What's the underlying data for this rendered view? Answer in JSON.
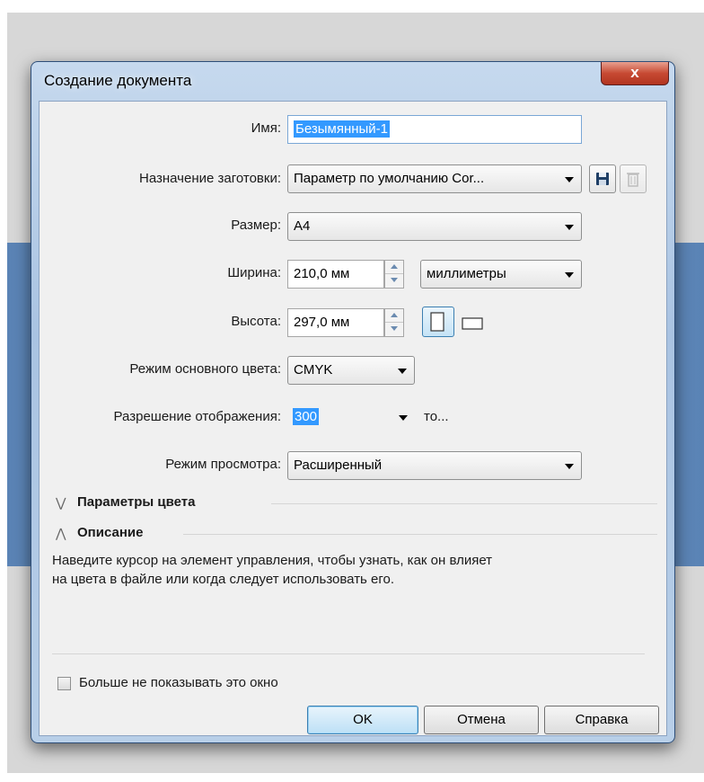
{
  "dialog": {
    "title": "Создание документа",
    "close_label": "x"
  },
  "form": {
    "name_label": "Имя:",
    "name_value": "Безымянный-1",
    "preset_label": "Назначение заготовки:",
    "preset_value": "Параметр по умолчанию Cor...",
    "size_label": "Размер:",
    "size_value": "A4",
    "width_label": "Ширина:",
    "width_value": "210,0 мм",
    "units_value": "миллиметры",
    "height_label": "Высота:",
    "height_value": "297,0 мм",
    "color_mode_label": "Режим основного цвета:",
    "color_mode_value": "CMYK",
    "resolution_label": "Разрешение отображения:",
    "resolution_value": "300",
    "resolution_unit": "то...",
    "preview_label": "Режим просмотра:",
    "preview_value": "Расширенный"
  },
  "sections": {
    "color_params": "Параметры цвета",
    "description": "Описание",
    "description_text_line1": "Наведите курсор на элемент управления, чтобы узнать, как он влияет",
    "description_text_line2": "на цвета в файле или когда следует использовать его."
  },
  "footer": {
    "dont_show_label": "Больше не показывать это окно",
    "ok_label": "OK",
    "cancel_label": "Отмена",
    "help_label": "Справка"
  },
  "icons": {
    "save_preset": "save-icon",
    "delete_preset": "trash-icon",
    "portrait": "portrait-orientation-icon",
    "landscape": "landscape-orientation-icon"
  }
}
